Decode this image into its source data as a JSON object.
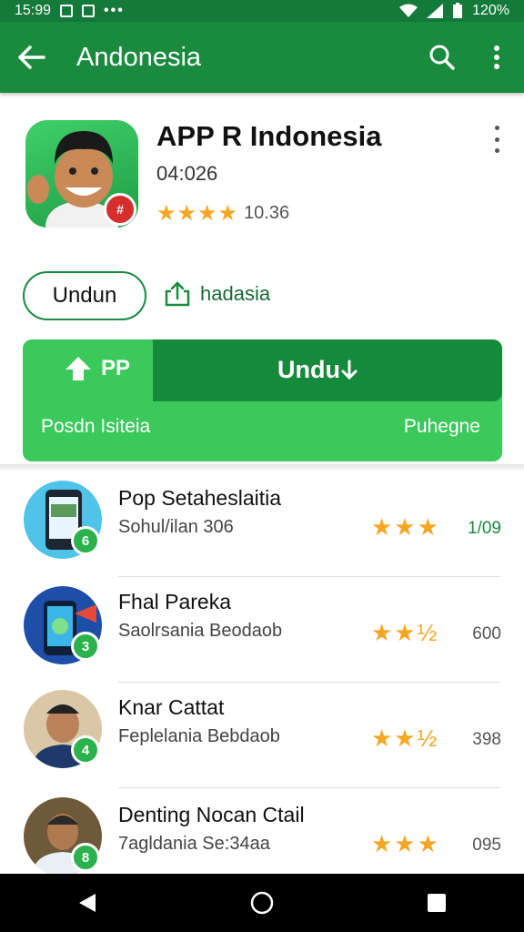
{
  "status_bar": {
    "time": "15:99",
    "battery": "120%"
  },
  "app_bar": {
    "title": "Andonesia"
  },
  "app": {
    "name": "APP R Indonesia",
    "meta": "04:026",
    "stars": "★★★★",
    "rating_count": "10.36"
  },
  "actions": {
    "install_label": "Undun",
    "share_label": "hadasia"
  },
  "banner": {
    "left_top": "PP",
    "download_label": "Undu",
    "left_bottom": "Posdn Isiteia",
    "right_bottom": "Puhegne"
  },
  "list": [
    {
      "title": "Pop Setaheslaitia",
      "subtitle": "Sohul/ilan 306",
      "stars": "★★★",
      "count": "1/09",
      "badge": "6"
    },
    {
      "title": "Fhal Pareka",
      "subtitle": "Saolrsania Beodaob",
      "stars": "★★½",
      "count": "600",
      "badge": "3"
    },
    {
      "title": "Knar Cattat",
      "subtitle": "Feplelania Bebdaob",
      "stars": "★★½",
      "count": "398",
      "badge": "4"
    },
    {
      "title": "Denting Nocan Ctail",
      "subtitle": "7agldania Se:34aa",
      "stars": "★★★",
      "count": "095",
      "badge": "8"
    }
  ],
  "colors": {
    "primary": "#1a8a3e",
    "banner_light": "#3cc95c",
    "star": "#f5a623"
  }
}
